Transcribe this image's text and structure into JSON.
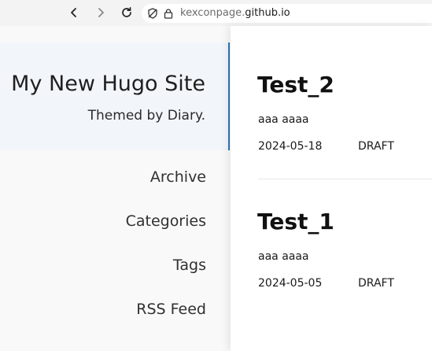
{
  "browser": {
    "url_prefix": "kexconpage.",
    "url_domain": "github.io",
    "back_icon": "chevron-left-icon",
    "forward_icon": "chevron-right-icon",
    "reload_icon": "reload-icon",
    "tracking_icon": "tracking-protection-icon",
    "lock_icon": "lock-icon"
  },
  "sidebar": {
    "title": "My New Hugo Site",
    "subtitle": "Themed by Diary.",
    "accent_color": "#2d74b5",
    "nav": [
      "Archive",
      "Categories",
      "Tags",
      "RSS Feed"
    ]
  },
  "posts": [
    {
      "title": "Test_2",
      "summary": "aaa aaaa",
      "date": "2024-05-18",
      "status": "DRAFT"
    },
    {
      "title": "Test_1",
      "summary": "aaa aaaa",
      "date": "2024-05-05",
      "status": "DRAFT"
    }
  ]
}
